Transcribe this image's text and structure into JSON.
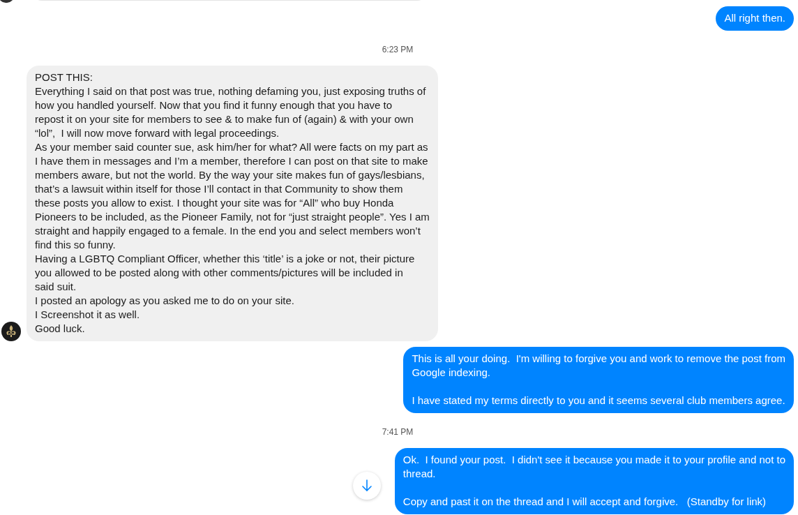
{
  "messages": [
    {
      "kind": "clipped"
    },
    {
      "kind": "sent",
      "text": "All right then."
    },
    {
      "kind": "timestamp",
      "text": "6:23 PM"
    },
    {
      "kind": "received",
      "avatar": true,
      "text": "POST THIS:\nEverything I said on that post was true, nothing defaming you, just exposing truths of\nhow you handled yourself. Now that you find it funny enough that you have to\nrepost it on your site for members to see & to make fun of (again) & with your own\n“lol”,  I will now move forward with legal proceedings.\nAs your member said counter sue, ask him/her for what? All were facts on my part as\nI have them in messages and I’m a member, therefore I can post on that site to make\nmembers aware, but not the world. By the way your site makes fun of gays/lesbians,\nthat’s a lawsuit within itself for those I’ll contact in that Community to show them\nthese posts you allow to exist. I thought your site was for “All” who buy Honda\nPioneers to be included, as the Pioneer Family, not for “just straight people”. Yes I am\nstraight and happily engaged to a female. In the end you and select members won’t\nfind this so funny.\nHaving a LGBTQ Compliant Officer, whether this ‘title’ is a joke or not, their picture\nyou allowed to be posted along with other comments/pictures will be included in\nsaid suit.\nI posted an apology as you asked me to do on your site.\nI Screenshot it as well.\nGood luck."
    },
    {
      "kind": "sent",
      "text": "This is all your doing.  I'm willing to forgive you and work to remove the post from\nGoogle indexing.\n\nI have stated my terms directly to you and it seems several club members agree."
    },
    {
      "kind": "timestamp",
      "text": "7:41 PM"
    },
    {
      "kind": "sent",
      "text": "Ok.  I found your post.  I didn't see it because you made it to your profile and not to\nthread.\n\nCopy and past it on the thread and I will accept and forgive.   (Standby for link)"
    }
  ],
  "scroll_down_button": true
}
